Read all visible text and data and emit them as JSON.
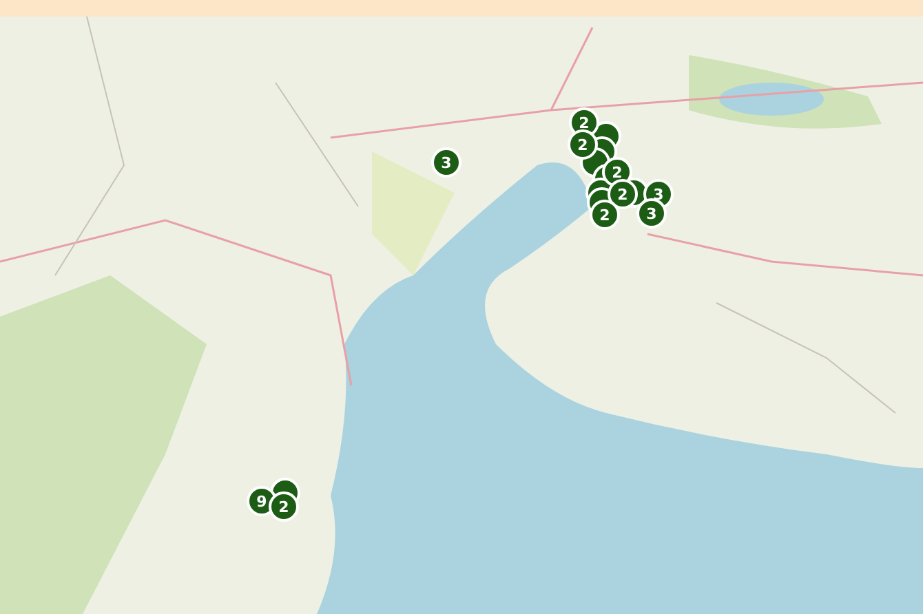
{
  "map": {
    "markers": [
      {
        "kind": "cluster",
        "label": "2"
      },
      {
        "kind": "cluster",
        "label": "2"
      },
      {
        "kind": "cluster",
        "label": "2"
      },
      {
        "kind": "cluster",
        "label": "2"
      },
      {
        "kind": "cluster",
        "label": "3"
      },
      {
        "kind": "cluster",
        "label": "2"
      },
      {
        "kind": "cluster",
        "label": "3"
      },
      {
        "kind": "cluster",
        "label": "3"
      },
      {
        "kind": "cluster",
        "label": "9"
      },
      {
        "kind": "cluster",
        "label": "2"
      }
    ]
  }
}
